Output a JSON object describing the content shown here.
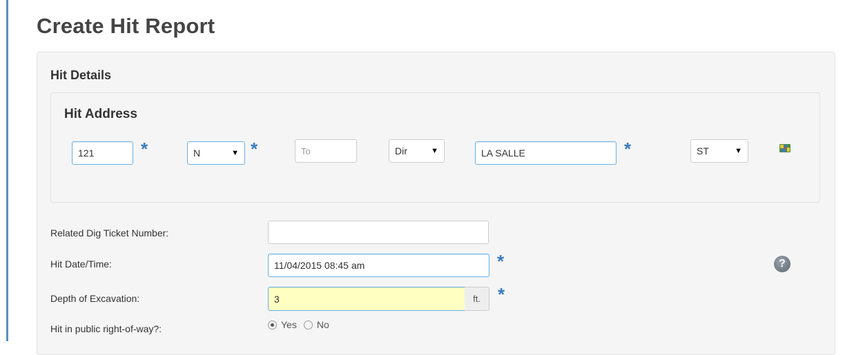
{
  "page": {
    "title": "Create Hit Report"
  },
  "hit_details": {
    "title": "Hit Details",
    "address": {
      "title": "Hit Address",
      "house_number": "121",
      "prefix_dir": "N",
      "to_placeholder": "To",
      "suffix_dir": "Dir",
      "street_name": "LA SALLE",
      "street_type": "ST",
      "map_icon": "map-icon"
    }
  },
  "form": {
    "related_ticket": {
      "label": "Related Dig Ticket Number:",
      "value": ""
    },
    "hit_datetime": {
      "label": "Hit Date/Time:",
      "value": "11/04/2015 08:45 am"
    },
    "depth": {
      "label": "Depth of Excavation:",
      "value": "3",
      "unit": "ft."
    },
    "public_row": {
      "label": "Hit in public right-of-way?:",
      "options": [
        "Yes",
        "No"
      ],
      "selected": "Yes"
    },
    "help_icon": "question-circle-icon"
  },
  "colors": {
    "required_star": "#3a7bbf",
    "highlight_field": "#ffffc2",
    "focus_border": "#66afe9"
  }
}
